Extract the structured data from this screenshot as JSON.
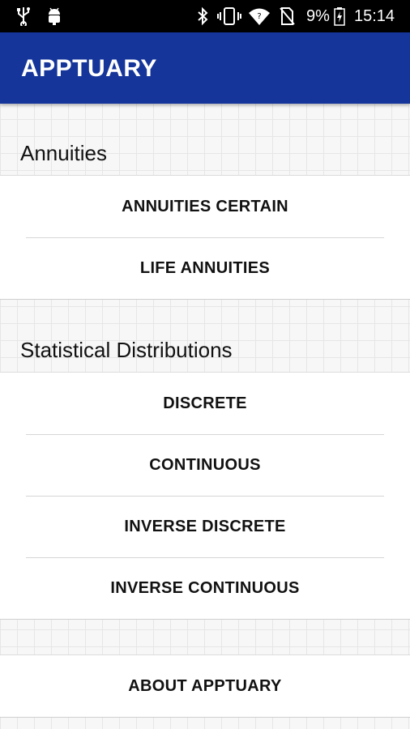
{
  "status_bar": {
    "battery_percent": "9%",
    "time": "15:14",
    "icons": [
      "usb-icon",
      "android-debug-icon",
      "bluetooth-icon",
      "vibrate-icon",
      "wifi-icon",
      "no-sim-icon",
      "battery-charging-icon"
    ]
  },
  "app_bar": {
    "title": "APPTUARY",
    "color": "#15359a"
  },
  "sections": [
    {
      "header": "Annuities",
      "items": [
        "ANNUITIES CERTAIN",
        "LIFE ANNUITIES"
      ]
    },
    {
      "header": "Statistical Distributions",
      "items": [
        "DISCRETE",
        "CONTINUOUS",
        "INVERSE DISCRETE",
        "INVERSE CONTINUOUS"
      ]
    }
  ],
  "about": {
    "label": "ABOUT APPTUARY"
  }
}
